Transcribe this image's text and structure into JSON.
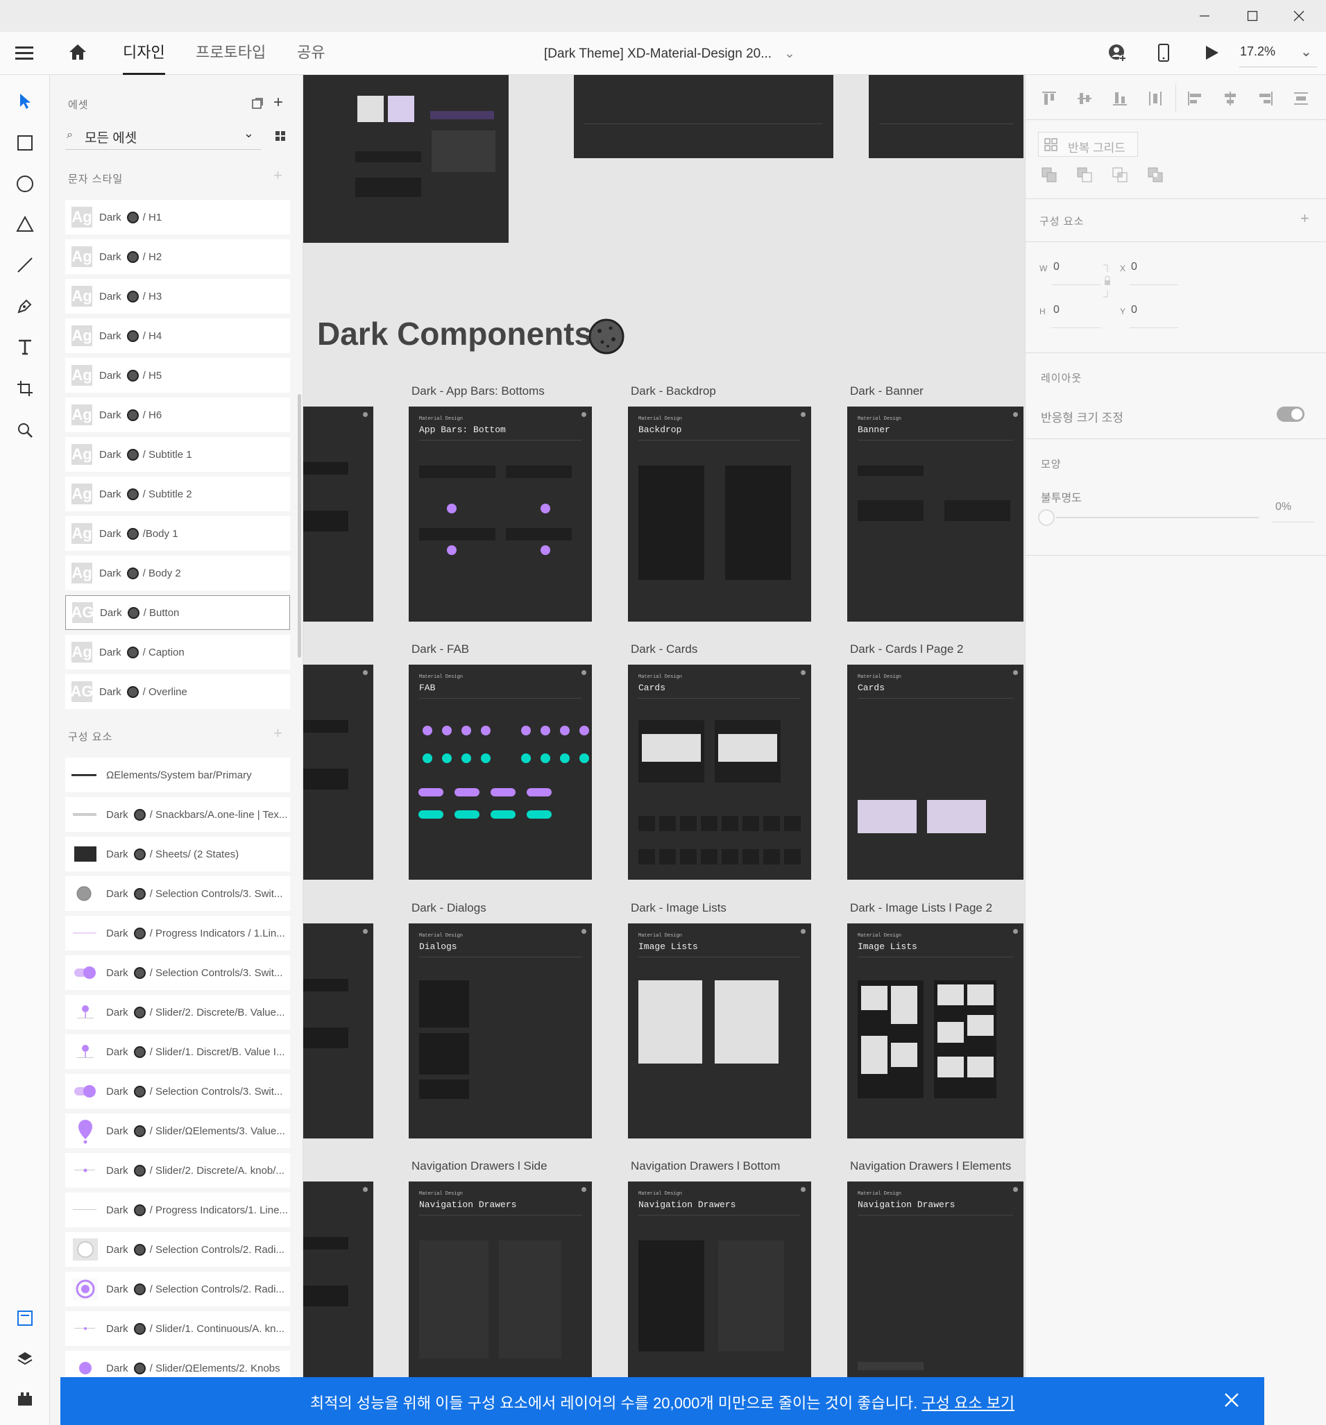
{
  "window": {
    "minimize_icon": "minimize-icon",
    "maximize_icon": "maximize-icon",
    "close_icon": "close-icon"
  },
  "menu": {
    "tabs": [
      {
        "label": "디자인"
      },
      {
        "label": "프로토타입"
      },
      {
        "label": "공유"
      }
    ],
    "doc_title": "[Dark Theme] XD-Material-Design 20...",
    "zoom": "17.2%"
  },
  "assets": {
    "title": "에셋",
    "filter_value": "모든 에셋",
    "char_styles_title": "문자 스타일",
    "components_title": "구성 요소",
    "char_styles": [
      {
        "ag": "Ag",
        "prefix": "Dark",
        "name": "/ H1"
      },
      {
        "ag": "Ag",
        "prefix": "Dark",
        "name": "/ H2"
      },
      {
        "ag": "Ag",
        "prefix": "Dark",
        "name": "/ H3"
      },
      {
        "ag": "Ag",
        "prefix": "Dark",
        "name": "/ H4"
      },
      {
        "ag": "Ag",
        "prefix": "Dark",
        "name": "/ H5"
      },
      {
        "ag": "Ag",
        "prefix": "Dark",
        "name": "/ H6"
      },
      {
        "ag": "Ag",
        "prefix": "Dark",
        "name": "/ Subtitle 1"
      },
      {
        "ag": "Ag",
        "prefix": "Dark",
        "name": "/ Subtitle 2"
      },
      {
        "ag": "Ag",
        "prefix": "Dark",
        "name": "/Body 1"
      },
      {
        "ag": "Ag",
        "prefix": "Dark",
        "name": "/ Body 2"
      },
      {
        "ag": "AG",
        "prefix": "Dark",
        "name": "/ Button"
      },
      {
        "ag": "Ag",
        "prefix": "Dark",
        "name": "/ Caption"
      },
      {
        "ag": "AG",
        "prefix": "Dark",
        "name": "/ Overline"
      }
    ],
    "components": [
      {
        "prefix": "",
        "name": "ΩElements/System bar/Primary"
      },
      {
        "prefix": "Dark",
        "name": "/ Snackbars/A.one-line | Tex..."
      },
      {
        "prefix": "Dark",
        "name": "/ Sheets/ (2 States)"
      },
      {
        "prefix": "Dark",
        "name": "/ Selection Controls/3. Swit..."
      },
      {
        "prefix": "Dark",
        "name": "/ Progress Indicators / 1.Lin..."
      },
      {
        "prefix": "Dark",
        "name": "/ Selection Controls/3. Swit..."
      },
      {
        "prefix": "Dark",
        "name": "/ Slider/2. Discrete/B. Value..."
      },
      {
        "prefix": "Dark",
        "name": "/ Slider/1. Discret/B. Value I..."
      },
      {
        "prefix": "Dark",
        "name": "/ Selection Controls/3. Swit..."
      },
      {
        "prefix": "Dark",
        "name": "/ Slider/ΩElements/3. Value..."
      },
      {
        "prefix": "Dark",
        "name": "/ Slider/2. Discrete/A. knob/..."
      },
      {
        "prefix": "Dark",
        "name": "/ Progress Indicators/1. Line..."
      },
      {
        "prefix": "Dark",
        "name": "/ Selection Controls/2. Radi..."
      },
      {
        "prefix": "Dark",
        "name": "/ Selection Controls/2. Radi..."
      },
      {
        "prefix": "Dark",
        "name": "/ Slider/1. Continuous/A. kn..."
      },
      {
        "prefix": "Dark",
        "name": "/ Slider/ΩElements/2. Knobs"
      }
    ]
  },
  "canvas": {
    "section_title": "Dark Components",
    "artboards": [
      {
        "label": "Dark - App Bars: Bottoms",
        "sub": "App Bars: Bottom"
      },
      {
        "label": "Dark - Backdrop",
        "sub": "Backdrop"
      },
      {
        "label": "Dark - Banner",
        "sub": "Banner"
      },
      {
        "label": "Dark - FAB",
        "sub": "FAB"
      },
      {
        "label": "Dark - Cards",
        "sub": "Cards"
      },
      {
        "label": "Dark - Cards l Page 2",
        "sub": "Cards"
      },
      {
        "label": "Dark - Dialogs",
        "sub": "Dialogs"
      },
      {
        "label": "Dark - Image Lists",
        "sub": "Image Lists"
      },
      {
        "label": "Dark - Image Lists l Page 2",
        "sub": "Image Lists"
      },
      {
        "label": "Navigation Drawers l Side",
        "sub": "Navigation Drawers"
      },
      {
        "label": "Navigation Drawers l Bottom",
        "sub": "Navigation Drawers"
      },
      {
        "label": "Navigation Drawers l Elements",
        "sub": "Navigation Drawers"
      }
    ],
    "artboard_header": "Material Design"
  },
  "properties": {
    "repeat_grid": "반복 그리드",
    "component_title": "구성 요소",
    "w_label": "W",
    "w": "0",
    "x_label": "X",
    "x": "0",
    "h_label": "H",
    "h": "0",
    "y_label": "Y",
    "y": "0",
    "layout_title": "레이아웃",
    "responsive_resize": "반응형 크기 조정",
    "appearance_title": "모양",
    "opacity_label": "불투명도",
    "opacity_value": "0%"
  },
  "banner": {
    "message": "최적의 성능을 위해 이들 구성 요소에서 레이어의 수를 20,000개 미만으로 줄이는 것이 좋습니다.",
    "link": "구성 요소 보기"
  },
  "colors": {
    "accent": "#1473e6",
    "purple": "#bb86fc",
    "teal": "#03dac5",
    "artboard": "#2c2c2c"
  }
}
